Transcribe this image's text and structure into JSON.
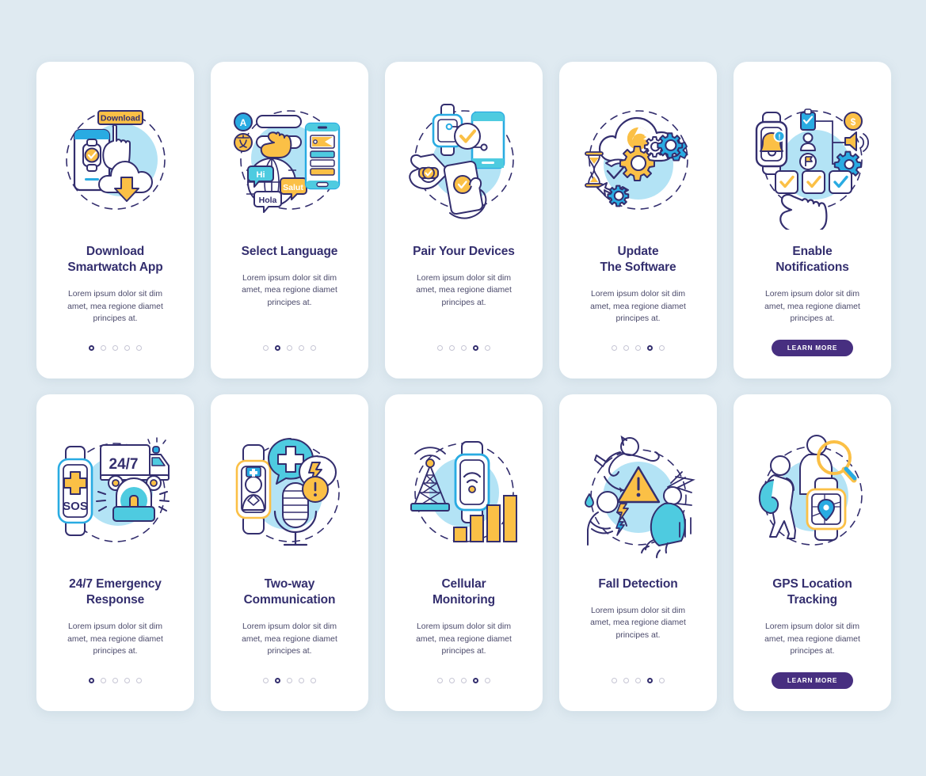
{
  "theme": {
    "page_background": "#dfeaf1",
    "card_background": "#ffffff",
    "title_color": "#332e6e",
    "body_color": "#4b4a6b",
    "accent_purple": "#472f80",
    "accent_blue": "#29abe2",
    "accent_cyan": "#4ecbe0",
    "accent_yellow": "#fbc046",
    "circle_fill": "#b3e3f5",
    "dot_inactive": "#c6c5d4",
    "dot_active": "#332e6e"
  },
  "common": {
    "body_text": "Lorem ipsum dolor sit dim\namet, mea regione diamet\nprincipes at.",
    "learn_more_label": "LEARN MORE",
    "dots_total": 5
  },
  "cards": [
    {
      "id": "download-smartwatch-app",
      "title": "Download\nSmartwatch App",
      "body": "Lorem ipsum dolor sit dim\namet, mea regione diamet\nprincipes at.",
      "dots_total": 5,
      "dot_active_index": 0,
      "has_button": false,
      "button_label": "",
      "illustration": "download-app-illustration",
      "illustration_labels": [
        "Download"
      ]
    },
    {
      "id": "select-language",
      "title": "Select Language",
      "body": "Lorem ipsum dolor sit dim\namet, mea regione diamet\nprincipes at.",
      "dots_total": 5,
      "dot_active_index": 1,
      "has_button": false,
      "button_label": "",
      "illustration": "select-language-illustration",
      "illustration_labels": [
        "A",
        "Hi",
        "Salut",
        "Hola"
      ]
    },
    {
      "id": "pair-your-devices",
      "title": "Pair Your Devices",
      "body": "Lorem ipsum dolor sit dim\namet, mea regione diamet\nprincipes at.",
      "dots_total": 5,
      "dot_active_index": 3,
      "has_button": false,
      "button_label": "",
      "illustration": "pair-devices-illustration",
      "illustration_labels": []
    },
    {
      "id": "update-the-software",
      "title": "Update\nThe Software",
      "body": "Lorem ipsum dolor sit dim\namet, mea regione diamet\nprincipes at.",
      "dots_total": 5,
      "dot_active_index": 3,
      "has_button": false,
      "button_label": "",
      "illustration": "update-software-illustration",
      "illustration_labels": []
    },
    {
      "id": "enable-notifications",
      "title": "Enable\nNotifications",
      "body": "Lorem ipsum dolor sit dim\namet, mea regione diamet\nprincipes at.",
      "dots_total": 0,
      "dot_active_index": -1,
      "has_button": true,
      "button_label": "LEARN MORE",
      "illustration": "enable-notifications-illustration",
      "illustration_labels": [
        "$"
      ]
    },
    {
      "id": "emergency-response",
      "title": "24/7 Emergency\nResponse",
      "body": "Lorem ipsum dolor sit dim\namet, mea regione diamet\nprincipes at.",
      "dots_total": 5,
      "dot_active_index": 0,
      "has_button": false,
      "button_label": "",
      "illustration": "emergency-response-illustration",
      "illustration_labels": [
        "24/7",
        "SOS"
      ]
    },
    {
      "id": "two-way-communication",
      "title": "Two-way\nCommunication",
      "body": "Lorem ipsum dolor sit dim\namet, mea regione diamet\nprincipes at.",
      "dots_total": 5,
      "dot_active_index": 1,
      "has_button": false,
      "button_label": "",
      "illustration": "two-way-communication-illustration",
      "illustration_labels": []
    },
    {
      "id": "cellular-monitoring",
      "title": "Cellular\nMonitoring",
      "body": "Lorem ipsum dolor sit dim\namet, mea regione diamet\nprincipes at.",
      "dots_total": 5,
      "dot_active_index": 3,
      "has_button": false,
      "button_label": "",
      "illustration": "cellular-monitoring-illustration",
      "illustration_labels": []
    },
    {
      "id": "fall-detection",
      "title": "Fall Detection",
      "body": "Lorem ipsum dolor sit dim\namet, mea regione diamet\nprincipes at.",
      "dots_total": 5,
      "dot_active_index": 3,
      "has_button": false,
      "button_label": "",
      "illustration": "fall-detection-illustration",
      "illustration_labels": []
    },
    {
      "id": "gps-location-tracking",
      "title": "GPS Location\nTracking",
      "body": "Lorem ipsum dolor sit dim\namet, mea regione diamet\nprincipes at.",
      "dots_total": 0,
      "dot_active_index": -1,
      "has_button": true,
      "button_label": "LEARN MORE",
      "illustration": "gps-tracking-illustration",
      "illustration_labels": []
    }
  ]
}
